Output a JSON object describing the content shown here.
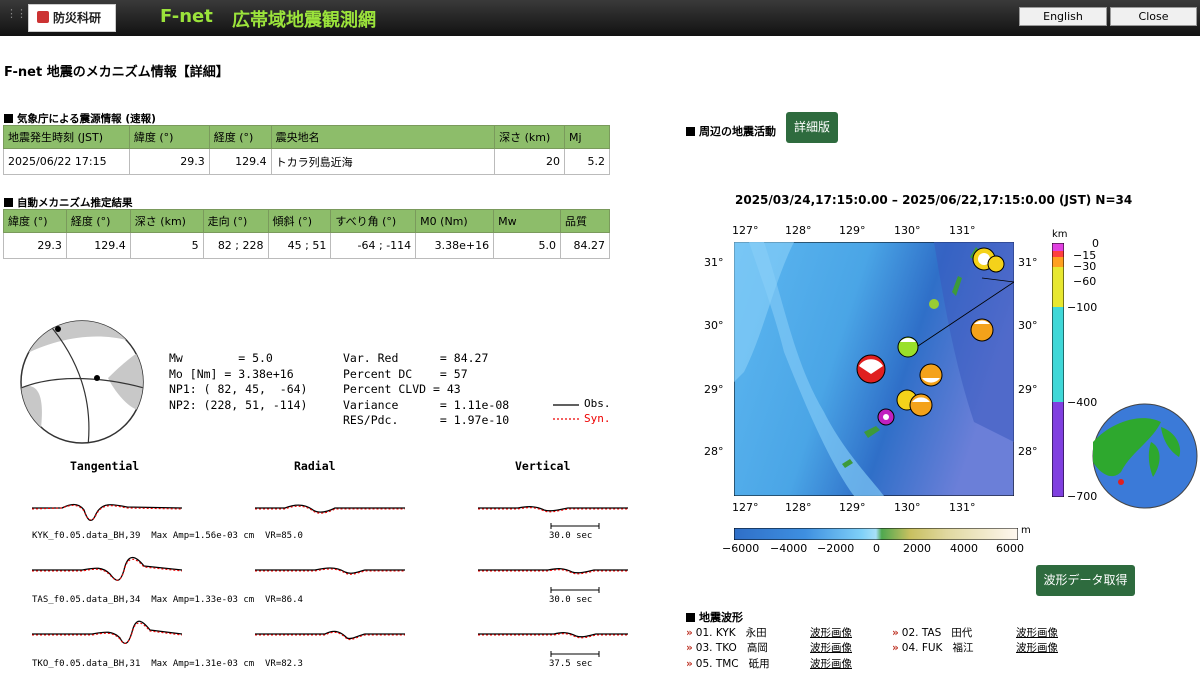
{
  "header": {
    "logo_text": "防災科研",
    "brand": "F-net",
    "brand_sub": "広帯域地震観測網",
    "english_btn": "English",
    "close_btn": "Close"
  },
  "page_title": "F-net 地震のメカニズム情報【詳細】",
  "jma": {
    "title": "気象庁による震源情報 (速報)",
    "headers": [
      "地震発生時刻 (JST)",
      "緯度 (°)",
      "経度 (°)",
      "震央地名",
      "深さ (km)",
      "Mj"
    ],
    "row": [
      "2025/06/22 17:15",
      "29.3",
      "129.4",
      "トカラ列島近海",
      "20",
      "5.2"
    ]
  },
  "mech": {
    "title": "自動メカニズム推定結果",
    "headers": [
      "緯度 (°)",
      "経度 (°)",
      "深さ (km)",
      "走向 (°)",
      "傾斜 (°)",
      "すべり角 (°)",
      "M0 (Nm)",
      "Mw",
      "品質"
    ],
    "row": [
      "29.3",
      "129.4",
      "5",
      "82 ; 228",
      "45 ; 51",
      "-64 ; -114",
      "3.38e+16",
      "5.0",
      "84.27"
    ]
  },
  "params_left": "Mw        = 5.0\nMo [Nm] = 3.38e+16\nNP1: ( 82, 45,  -64)\nNP2: (228, 51, -114)",
  "params_right": "Var. Red      = 84.27\nPercent DC    = 57\nPercent CLVD = 43\nVariance      = 1.11e-08\nRES/Pdc.      = 1.97e-10",
  "legend": {
    "obs": "Obs.",
    "syn": "Syn."
  },
  "wave_cols": [
    "Tangential",
    "Radial",
    "Vertical"
  ],
  "wave_rows": [
    {
      "label": "KYK_f0.05.data_BH,39  Max Amp=1.56e-03 cm  VR=85.0",
      "scale": "30.0 sec"
    },
    {
      "label": "TAS_f0.05.data_BH,34  Max Amp=1.33e-03 cm  VR=86.4",
      "scale": "30.0 sec"
    },
    {
      "label": "TKO_f0.05.data_BH,31  Max Amp=1.31e-03 cm  VR=82.3",
      "scale": "37.5 sec"
    }
  ],
  "activity": {
    "title": "周辺の地震活動",
    "detail_btn": "詳細版",
    "map_title": "2025/03/24,17:15:0.00 – 2025/06/22,17:15:0.00 (JST)  N=34",
    "lon_ticks": [
      "127°",
      "128°",
      "129°",
      "130°",
      "131°"
    ],
    "lat_ticks": [
      "31°",
      "30°",
      "29°",
      "28°"
    ],
    "depth_unit": "km",
    "depth_ticks": [
      "0",
      "−15",
      "−30",
      "−60",
      "−100",
      "−400",
      "−700"
    ],
    "elev_ticks": [
      "−6000",
      "−4000",
      "−2000",
      "0",
      "2000",
      "4000",
      "6000"
    ],
    "elev_unit": "m"
  },
  "waveform_btn": "波形データ取得",
  "waveforms": {
    "title": "地震波形",
    "stations": [
      {
        "code": "01. KYK",
        "name": "永田",
        "link": "波形画像"
      },
      {
        "code": "02. TAS",
        "name": "田代",
        "link": "波形画像"
      },
      {
        "code": "03. TKO",
        "name": "高岡",
        "link": "波形画像"
      },
      {
        "code": "04. FUK",
        "name": "福江",
        "link": "波形画像"
      },
      {
        "code": "05. TMC",
        "name": "砥用",
        "link": "波形画像"
      }
    ]
  }
}
